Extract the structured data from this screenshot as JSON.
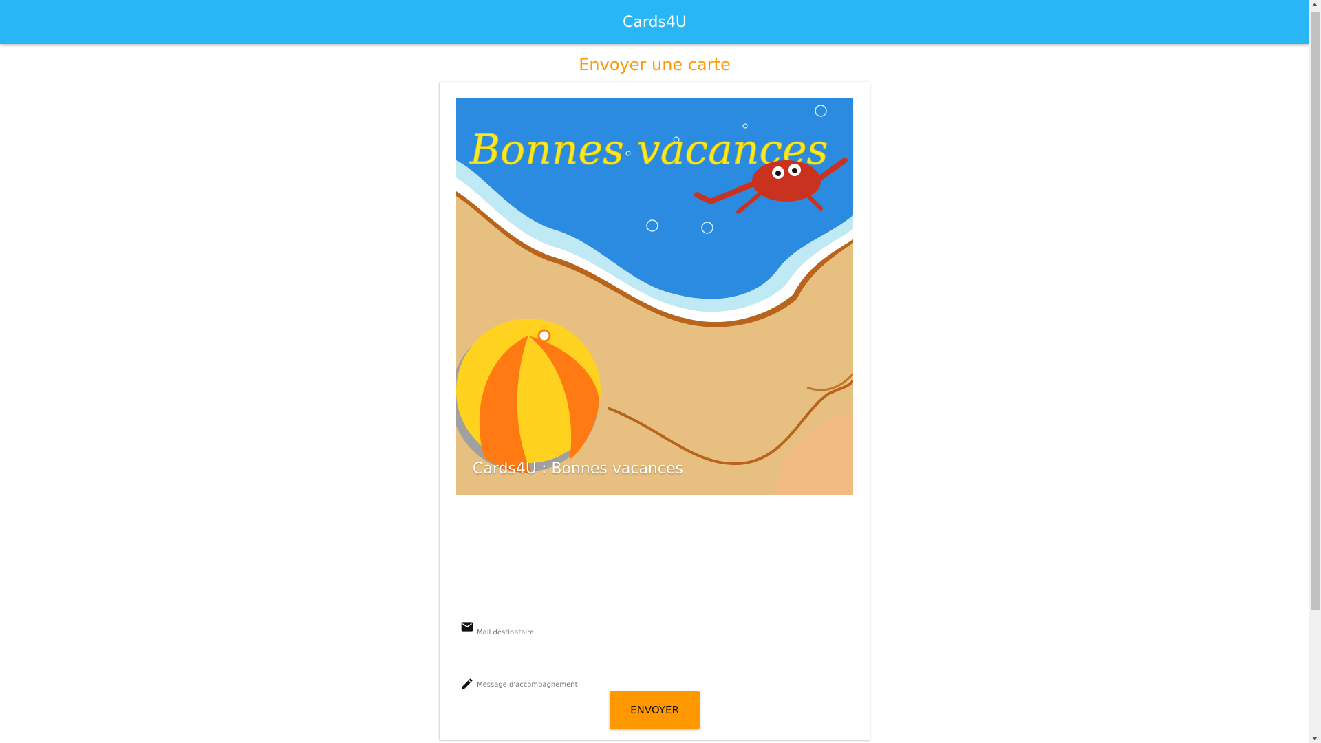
{
  "app": {
    "title": "Cards4U"
  },
  "page": {
    "title": "Envoyer une carte"
  },
  "card": {
    "image_text": "Bonnes vacances",
    "caption": "Cards4U : Bonnes vacances"
  },
  "form": {
    "email_label": "Mail destinataire",
    "message_label": "Message d'accompagnement"
  },
  "actions": {
    "send_label": "ENVOYER"
  },
  "icons": {
    "email": "mail-icon",
    "message": "pencil-icon"
  },
  "colors": {
    "appbar": "#29b6f6",
    "accent": "#ff9800"
  }
}
